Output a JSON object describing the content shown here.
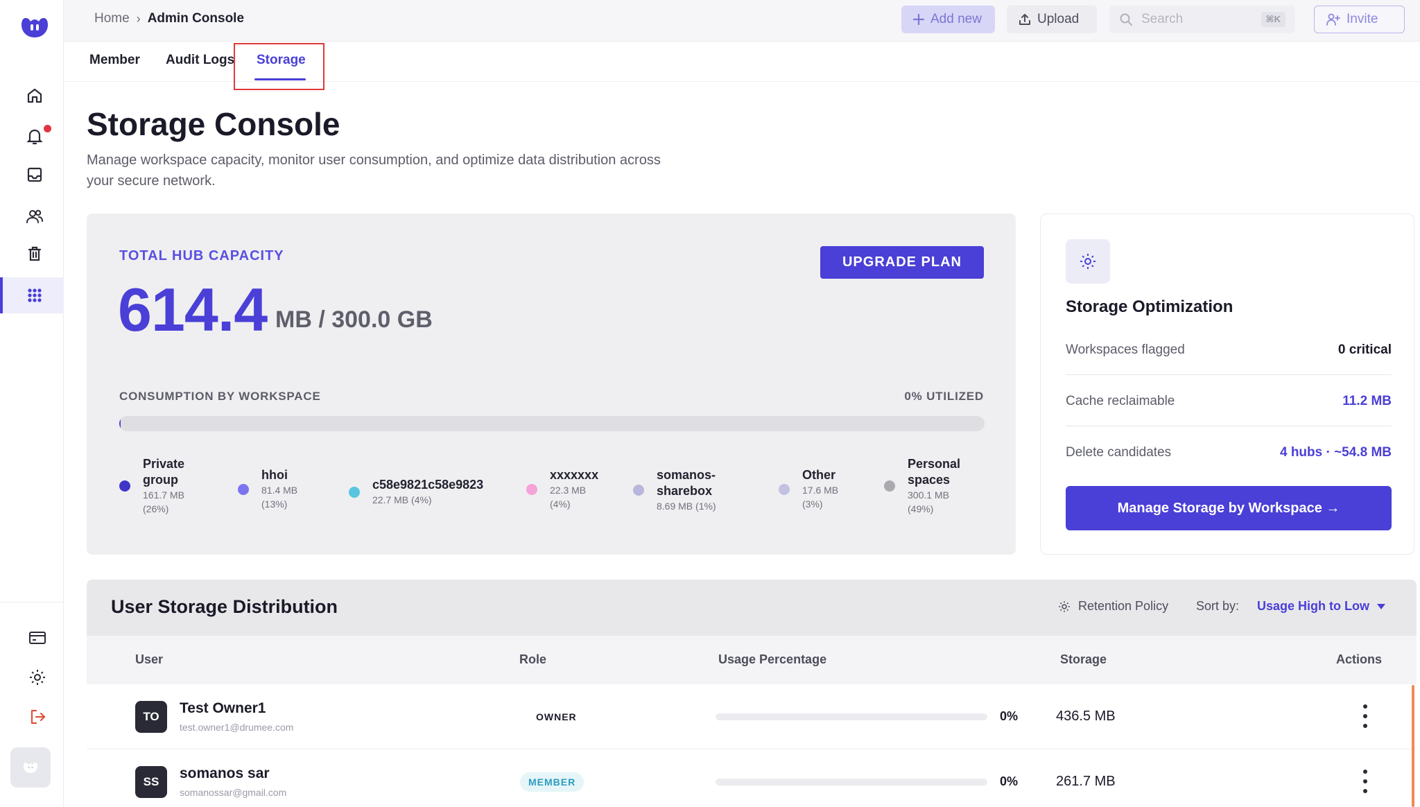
{
  "topbar": {
    "breadcrumb_home": "Home",
    "breadcrumb_sep": "›",
    "breadcrumb_current": "Admin Console",
    "add_new_label": "Add new",
    "upload_label": "Upload",
    "search_placeholder": "Search",
    "search_shortcut": "⌘K",
    "invite_label": "Invite"
  },
  "tabs": [
    {
      "label": "Member",
      "active": false
    },
    {
      "label": "Audit Logs",
      "active": false
    },
    {
      "label": "Storage",
      "active": true
    }
  ],
  "header": {
    "title": "Storage Console",
    "description": "Manage workspace capacity, monitor user consumption, and optimize data distribution across your secure network."
  },
  "capacity": {
    "label": "TOTAL HUB CAPACITY",
    "used": "614.4",
    "total": "MB / 300.0 GB",
    "upgrade_label": "UPGRADE PLAN",
    "consumption_label": "CONSUMPTION BY WORKSPACE",
    "utilized_label": "0% UTILIZED",
    "utilized_fraction": 0.002,
    "legend": [
      {
        "name_line1": "Private",
        "name_line2": "group",
        "size": "161.7 MB",
        "pct": "(26%)",
        "color": "#3f36c9"
      },
      {
        "name_line1": "hhoi",
        "name_line2": "",
        "size": "81.4 MB",
        "pct": "(13%)",
        "color": "#7b74ef"
      },
      {
        "name_line1": "c58e9821c58e9823",
        "name_line2": "",
        "size": "22.7 MB (4%)",
        "pct": "",
        "color": "#58c6de"
      },
      {
        "name_line1": "xxxxxxx",
        "name_line2": "",
        "size": "22.3 MB",
        "pct": "(4%)",
        "color": "#f5a3d6"
      },
      {
        "name_line1": "somanos-",
        "name_line2": "sharebox",
        "size": "8.69 MB (1%)",
        "pct": "",
        "color": "#b9b6dd"
      },
      {
        "name_line1": "Other",
        "name_line2": "",
        "size": "17.6 MB",
        "pct": "(3%)",
        "color": "#c3c1e0"
      },
      {
        "name_line1": "Personal",
        "name_line2": "spaces",
        "size": "300.1 MB",
        "pct": "(49%)",
        "color": "#a9a9ae"
      }
    ]
  },
  "optimization": {
    "title": "Storage Optimization",
    "rows": [
      {
        "label": "Workspaces flagged",
        "value": "0 critical",
        "color": "#1a1a28"
      },
      {
        "label": "Cache reclaimable",
        "value": "11.2 MB",
        "color": "#4a3fd6"
      },
      {
        "label": "Delete candidates",
        "value": "4 hubs · ~54.8 MB",
        "color": "#4a3fd6"
      }
    ],
    "manage_label": "Manage Storage by Workspace →"
  },
  "distribution": {
    "title": "User Storage Distribution",
    "retention_label": "Retention Policy",
    "sort_label": "Sort by:",
    "sort_value": "Usage High to Low",
    "columns": {
      "user": "User",
      "role": "Role",
      "usage": "Usage Percentage",
      "storage": "Storage",
      "actions": "Actions"
    },
    "rows": [
      {
        "initials": "TO",
        "name": "Test Owner1",
        "email": "test.owner1@drumee.com",
        "role": "OWNER",
        "usage": "0%",
        "storage": "436.5 MB"
      },
      {
        "initials": "SS",
        "name": "somanos sar",
        "email": "somanossar@gmail.com",
        "role": "MEMBER",
        "usage": "0%",
        "storage": "261.7 MB"
      }
    ]
  }
}
